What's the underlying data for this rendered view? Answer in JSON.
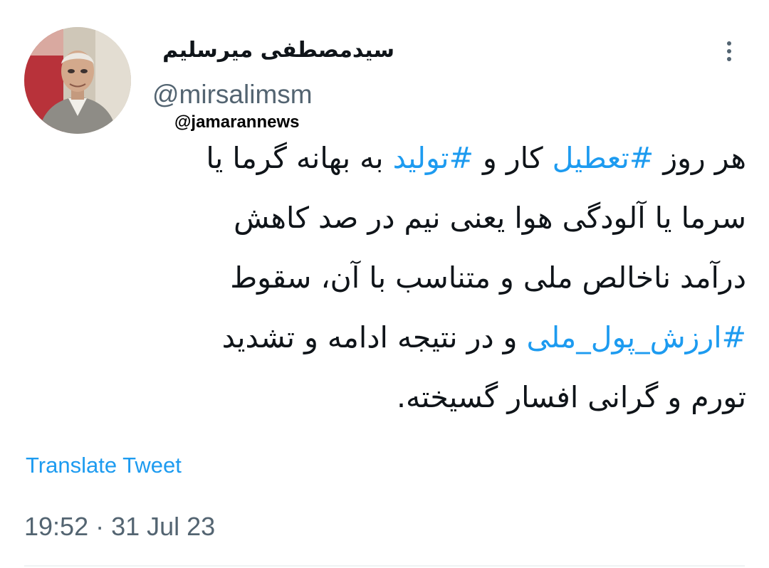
{
  "author": {
    "display_name": "سیدمصطفی میرسلیم",
    "handle": "@mirsalimsm"
  },
  "watermark": "@jamarannews",
  "tweet": {
    "lines": [
      [
        {
          "text": "هر روز ",
          "hashtag": false
        },
        {
          "text": "#تعطیل",
          "hashtag": true
        },
        {
          "text": " کار و ",
          "hashtag": false
        },
        {
          "text": "#تولید",
          "hashtag": true
        },
        {
          "text": " به بهانه گرما یا",
          "hashtag": false
        }
      ],
      [
        {
          "text": "سرما یا آلودگی هوا یعنی نیم در صد کاهش",
          "hashtag": false
        }
      ],
      [
        {
          "text": "درآمد ناخالص ملی و متناسب با آن،  سقوط",
          "hashtag": false
        }
      ],
      [
        {
          "text": "#ارزش_پول_ملی",
          "hashtag": true
        },
        {
          "text": " و در نتیجه ادامه و تشدید",
          "hashtag": false
        }
      ],
      [
        {
          "text": "تورم و گرانی افسار گسیخته.",
          "hashtag": false
        }
      ]
    ]
  },
  "actions": {
    "translate_label": "Translate Tweet"
  },
  "timestamp": "19:52 · 31 Jul 23",
  "icons": {
    "more": "more-vertical-icon"
  },
  "colors": {
    "hashtag": "#1d9bf0",
    "secondary_text": "#536471",
    "primary_text": "#0f1419"
  }
}
